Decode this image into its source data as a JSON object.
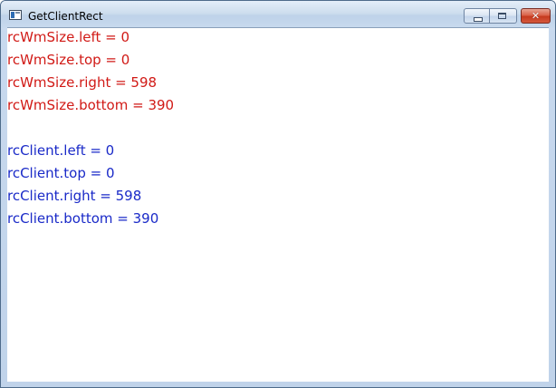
{
  "window": {
    "title": "GetClientRect",
    "buttons": {
      "minimize": "minimize",
      "maximize": "maximize",
      "close": "close"
    }
  },
  "colors": {
    "wmsize_text": "#d11a16",
    "client_text": "#1a2ac8"
  },
  "client": {
    "wmsize_lines": [
      "rcWmSize.left = 0",
      "rcWmSize.top = 0",
      "rcWmSize.right = 598",
      "rcWmSize.bottom = 390"
    ],
    "client_lines": [
      "rcClient.left = 0",
      "rcClient.top = 0",
      "rcClient.right = 598",
      "rcClient.bottom = 390"
    ]
  }
}
